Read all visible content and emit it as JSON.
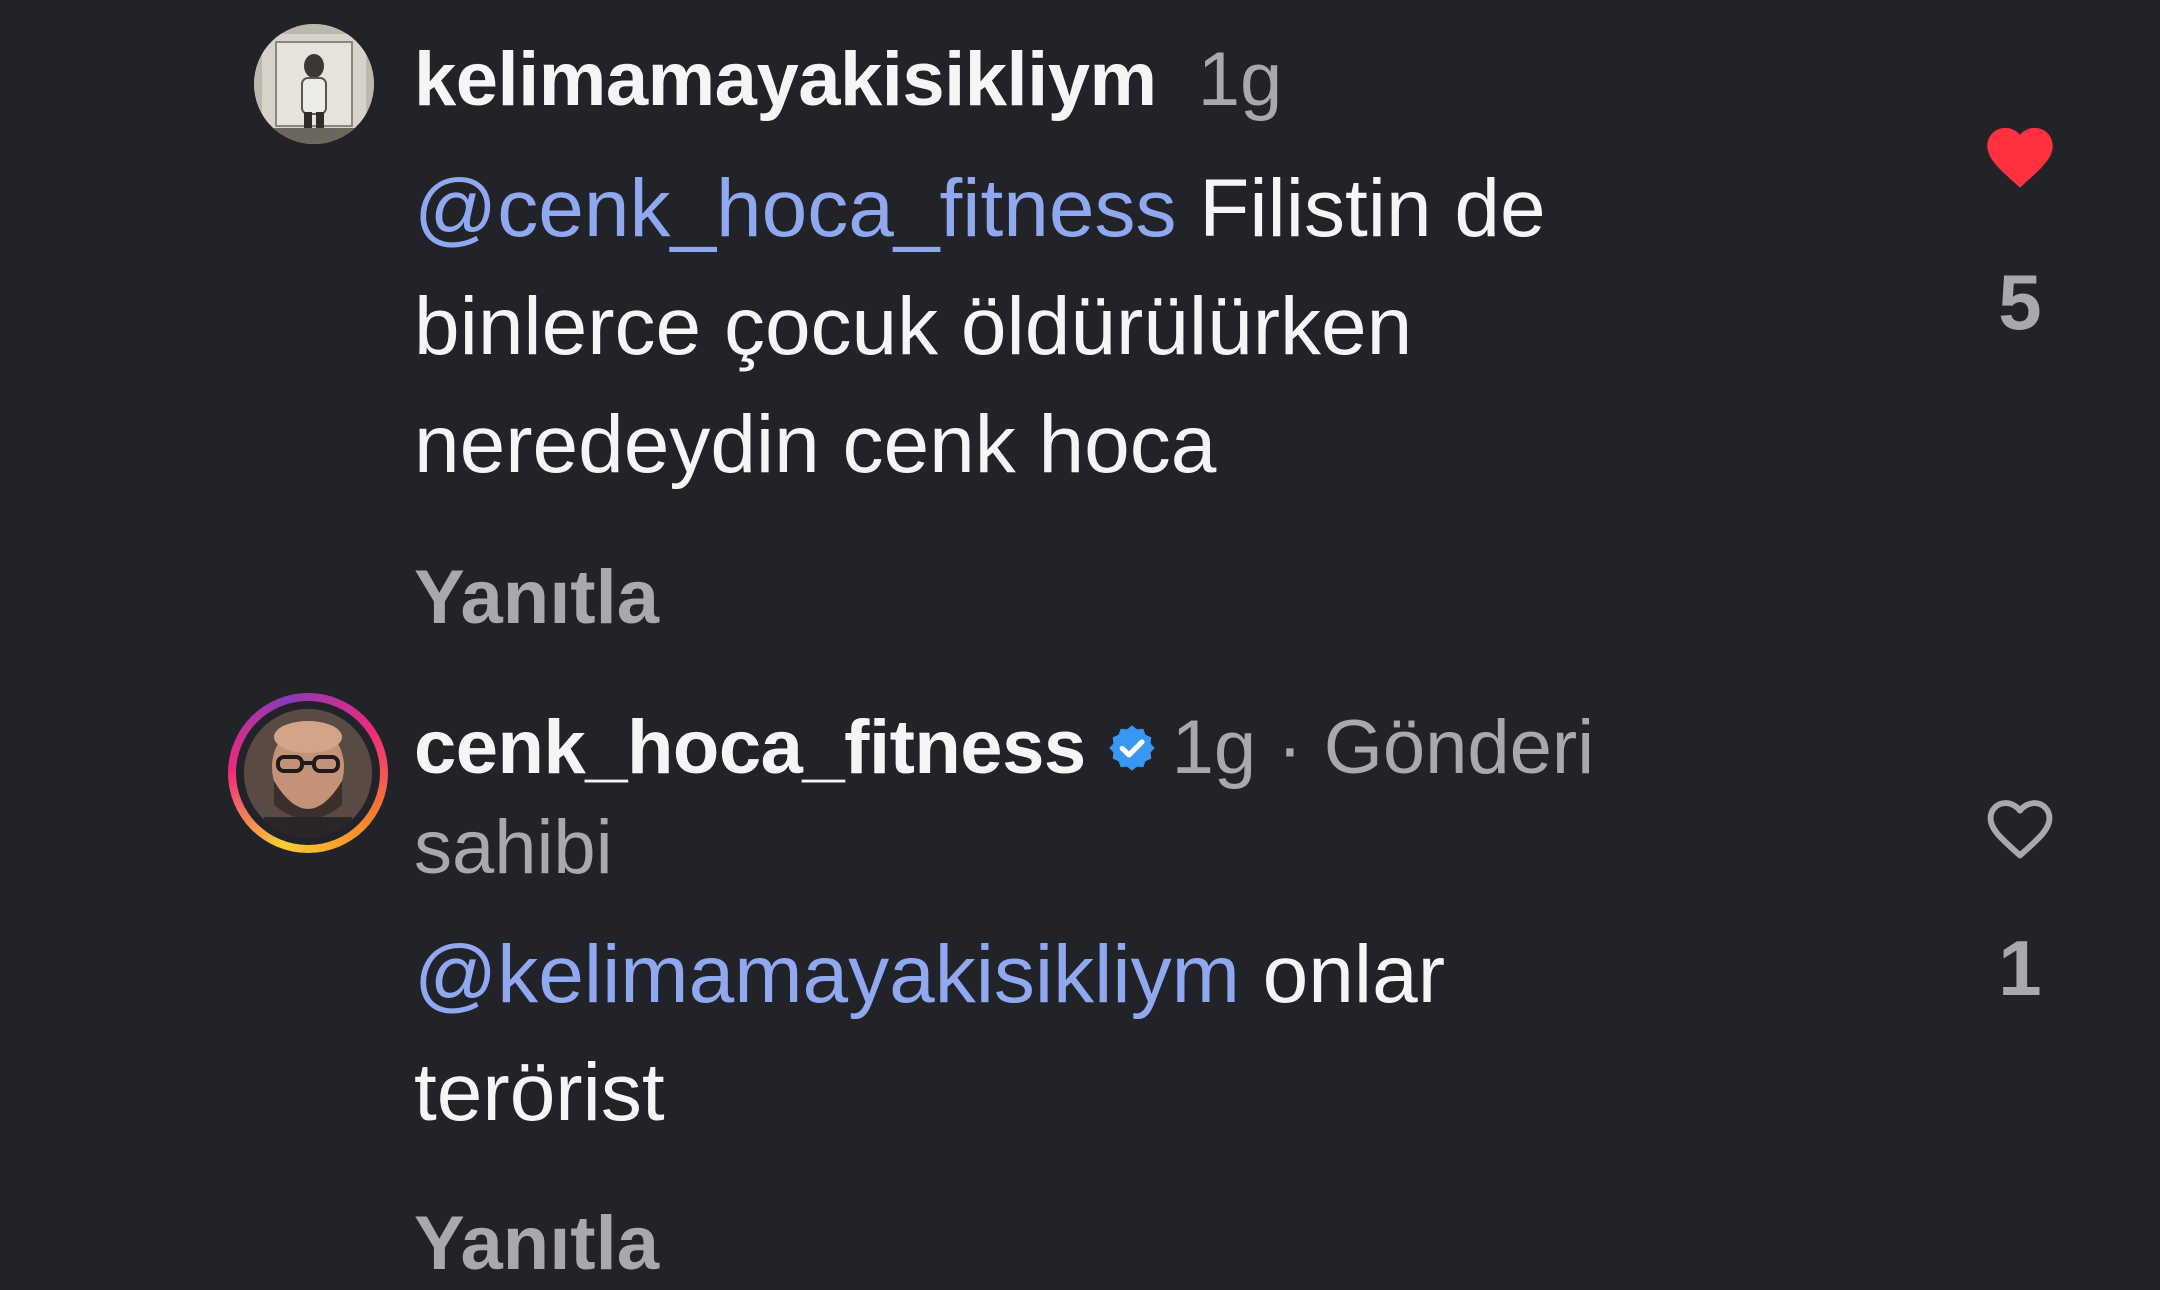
{
  "comments": [
    {
      "username": "kelimamayakisikliym",
      "time": "1g",
      "mention": "@cenk_hoca_fitness",
      "text_1": " Filistin de",
      "text_2": "binlerce çocuk öldürülürken",
      "text_3": "neredeydin cenk hoca",
      "reply_label": "Yanıtla",
      "like_count": "5",
      "liked": true,
      "like_color": "#ff3040"
    },
    {
      "username": "cenk_hoca_fitness",
      "verified": true,
      "time": "1g",
      "separator": " · ",
      "owner_label_1": "Gönderi",
      "owner_label_2": "sahibi",
      "mention": "@kelimamayakisikliym",
      "text_1": " onlar",
      "text_2": "terörist",
      "reply_label": "Yanıtla",
      "like_count": "1",
      "liked": false,
      "verified_color": "#3897f0"
    }
  ],
  "icons": {
    "like_filled": "heart-filled-icon",
    "like_outline": "heart-outline-icon",
    "verified": "verified-badge-icon"
  },
  "colors": {
    "background": "#222229",
    "text": "#f5f5f5",
    "secondary": "#a8a8ae",
    "mention": "#8fa8f0"
  }
}
